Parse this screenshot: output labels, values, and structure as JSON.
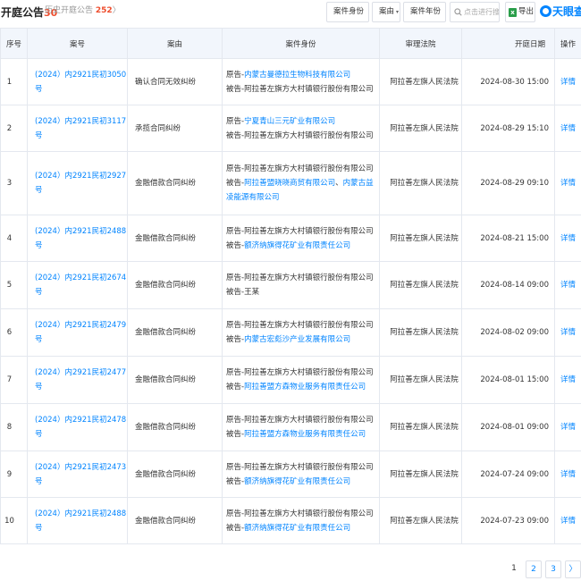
{
  "header": {
    "title": "开庭公告",
    "title_count": "30",
    "history_label": "历史开庭公告",
    "history_count": "252",
    "history_chevron": "〉",
    "filters": [
      {
        "label": "案件身份",
        "caret": "▾"
      },
      {
        "label": "案由",
        "caret": "▾"
      },
      {
        "label": "案件年份",
        "caret": "▾"
      }
    ],
    "search_placeholder": "点击进行搜索",
    "export_label": "导出",
    "brand_name": "天眼查",
    "brand_color": "#0084ff"
  },
  "table": {
    "columns": [
      "序号",
      "案号",
      "案由",
      "案件身份",
      "审理法院",
      "开庭日期",
      "操作"
    ],
    "rows": [
      {
        "idx": "1",
        "case_no": "(2024）内2921民初3050号",
        "reason": "确认合同无效纠纷",
        "plaintiff_prefix": "原告-",
        "plaintiff": "内蒙古曼德拉生物科技有限公司",
        "defendant_prefix": "被告-",
        "defendant": "阿拉善左旗方大村镇银行股份有限公司",
        "court": "阿拉善左旗人民法院",
        "date": "2024-08-30 15:00",
        "action": "详情"
      },
      {
        "idx": "2",
        "case_no": "(2024）内2921民初3117号",
        "reason": "承揽合同纠纷",
        "plaintiff_prefix": "原告-",
        "plaintiff": "宁夏青山三元矿业有限公司",
        "defendant_prefix": "被告-",
        "defendant": "阿拉善左旗方大村镇银行股份有限公司",
        "court": "阿拉善左旗人民法院",
        "date": "2024-08-29 15:10",
        "action": "详情"
      },
      {
        "idx": "3",
        "case_no": "(2024）内2921民初2927号",
        "reason": "金融借款合同纠纷",
        "plaintiff_prefix": "原告-",
        "plaintiff": "阿拉善左旗方大村镇银行股份有限公司",
        "defendant_prefix": "被告-",
        "defendant_a": "阿拉善盟晓晓商贸有限公司",
        "defendant_sep": "、",
        "defendant_b": "内蒙古益凌能源有限公司",
        "court": "阿拉善左旗人民法院",
        "date": "2024-08-29 09:10",
        "action": "详情"
      },
      {
        "idx": "4",
        "case_no": "(2024）内2921民初2488号",
        "reason": "金融借款合同纠纷",
        "plaintiff_prefix": "原告-",
        "plaintiff": "阿拉善左旗方大村镇银行股份有限公司",
        "defendant_prefix": "被告-",
        "defendant": "额济纳旗得花矿业有限责任公司",
        "court": "阿拉善左旗人民法院",
        "date": "2024-08-21 15:00",
        "action": "详情"
      },
      {
        "idx": "5",
        "case_no": "(2024）内2921民初2674号",
        "reason": "金融借款合同纠纷",
        "plaintiff_prefix": "原告-",
        "plaintiff": "阿拉善左旗方大村镇银行股份有限公司",
        "defendant_prefix": "被告-",
        "defendant": "王某",
        "court": "阿拉善左旗人民法院",
        "date": "2024-08-14 09:00",
        "action": "详情"
      },
      {
        "idx": "6",
        "case_no": "(2024）内2921民初2479号",
        "reason": "金融借款合同纠纷",
        "plaintiff_prefix": "原告-",
        "plaintiff": "阿拉善左旗方大村镇银行股份有限公司",
        "defendant_prefix": "被告-",
        "defendant": "内蒙古宏彪沙产业发展有限公司",
        "court": "阿拉善左旗人民法院",
        "date": "2024-08-02 09:00",
        "action": "详情"
      },
      {
        "idx": "7",
        "case_no": "(2024）内2921民初2477号",
        "reason": "金融借款合同纠纷",
        "plaintiff_prefix": "原告-",
        "plaintiff": "阿拉善左旗方大村镇银行股份有限公司",
        "defendant_prefix": "被告-",
        "defendant": "阿拉善盟方森物业服务有限责任公司",
        "court": "阿拉善左旗人民法院",
        "date": "2024-08-01 15:00",
        "action": "详情"
      },
      {
        "idx": "8",
        "case_no": "(2024）内2921民初2478号",
        "reason": "金融借款合同纠纷",
        "plaintiff_prefix": "原告-",
        "plaintiff": "阿拉善左旗方大村镇银行股份有限公司",
        "defendant_prefix": "被告-",
        "defendant": "阿拉善盟方森物业服务有限责任公司",
        "court": "阿拉善左旗人民法院",
        "date": "2024-08-01 09:00",
        "action": "详情"
      },
      {
        "idx": "9",
        "case_no": "(2024）内2921民初2473号",
        "reason": "金融借款合同纠纷",
        "plaintiff_prefix": "原告-",
        "plaintiff": "阿拉善左旗方大村镇银行股份有限公司",
        "defendant_prefix": "被告-",
        "defendant": "额济纳旗得花矿业有限责任公司",
        "court": "阿拉善左旗人民法院",
        "date": "2024-07-24 09:00",
        "action": "详情"
      },
      {
        "idx": "10",
        "case_no": "(2024）内2921民初2488号",
        "reason": "金融借款合同纠纷",
        "plaintiff_prefix": "原告-",
        "plaintiff": "阿拉善左旗方大村镇银行股份有限公司",
        "defendant_prefix": "被告-",
        "defendant": "额济纳旗得花矿业有限责任公司",
        "court": "阿拉善左旗人民法院",
        "date": "2024-07-23 09:00",
        "action": "详情"
      }
    ]
  },
  "pagination": {
    "pages": [
      "1",
      "2",
      "3"
    ],
    "current": "1",
    "next": "〉"
  }
}
